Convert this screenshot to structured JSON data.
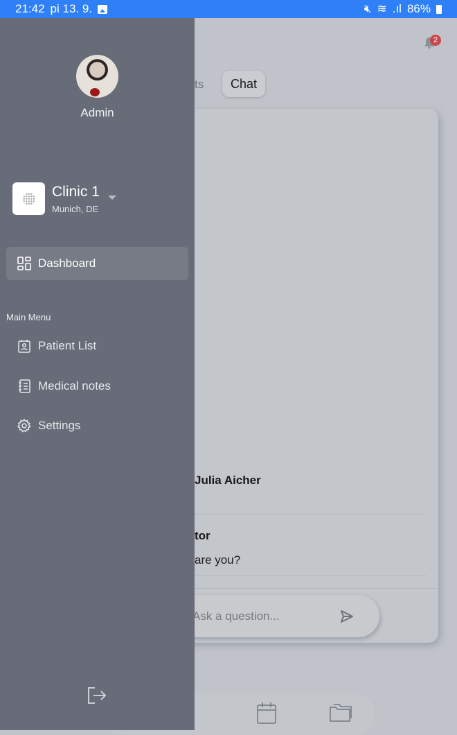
{
  "status_bar": {
    "time": "21:42",
    "date": "pi 13. 9.",
    "battery": "86%"
  },
  "header": {
    "notification_count": "2"
  },
  "tabs": {
    "partial_label": "ts",
    "active": "Chat"
  },
  "chat": {
    "messages": [
      {
        "name": "Julia Aicher",
        "text": ""
      },
      {
        "name": "tor",
        "text": "are you?"
      }
    ],
    "input_placeholder": "Ask a question..."
  },
  "drawer": {
    "user": "Admin",
    "clinic": {
      "name": "Clinic 1",
      "location": "Munich, DE"
    },
    "dashboard": "Dashboard",
    "section_label": "Main Menu",
    "items": [
      {
        "label": "Patient List",
        "icon": "patient-badge-icon"
      },
      {
        "label": "Medical notes",
        "icon": "notebook-icon"
      },
      {
        "label": "Settings",
        "icon": "gear-icon"
      }
    ]
  },
  "colors": {
    "status_bar": "#2f80f7",
    "drawer": "#676c78",
    "badge": "#c8474c"
  }
}
